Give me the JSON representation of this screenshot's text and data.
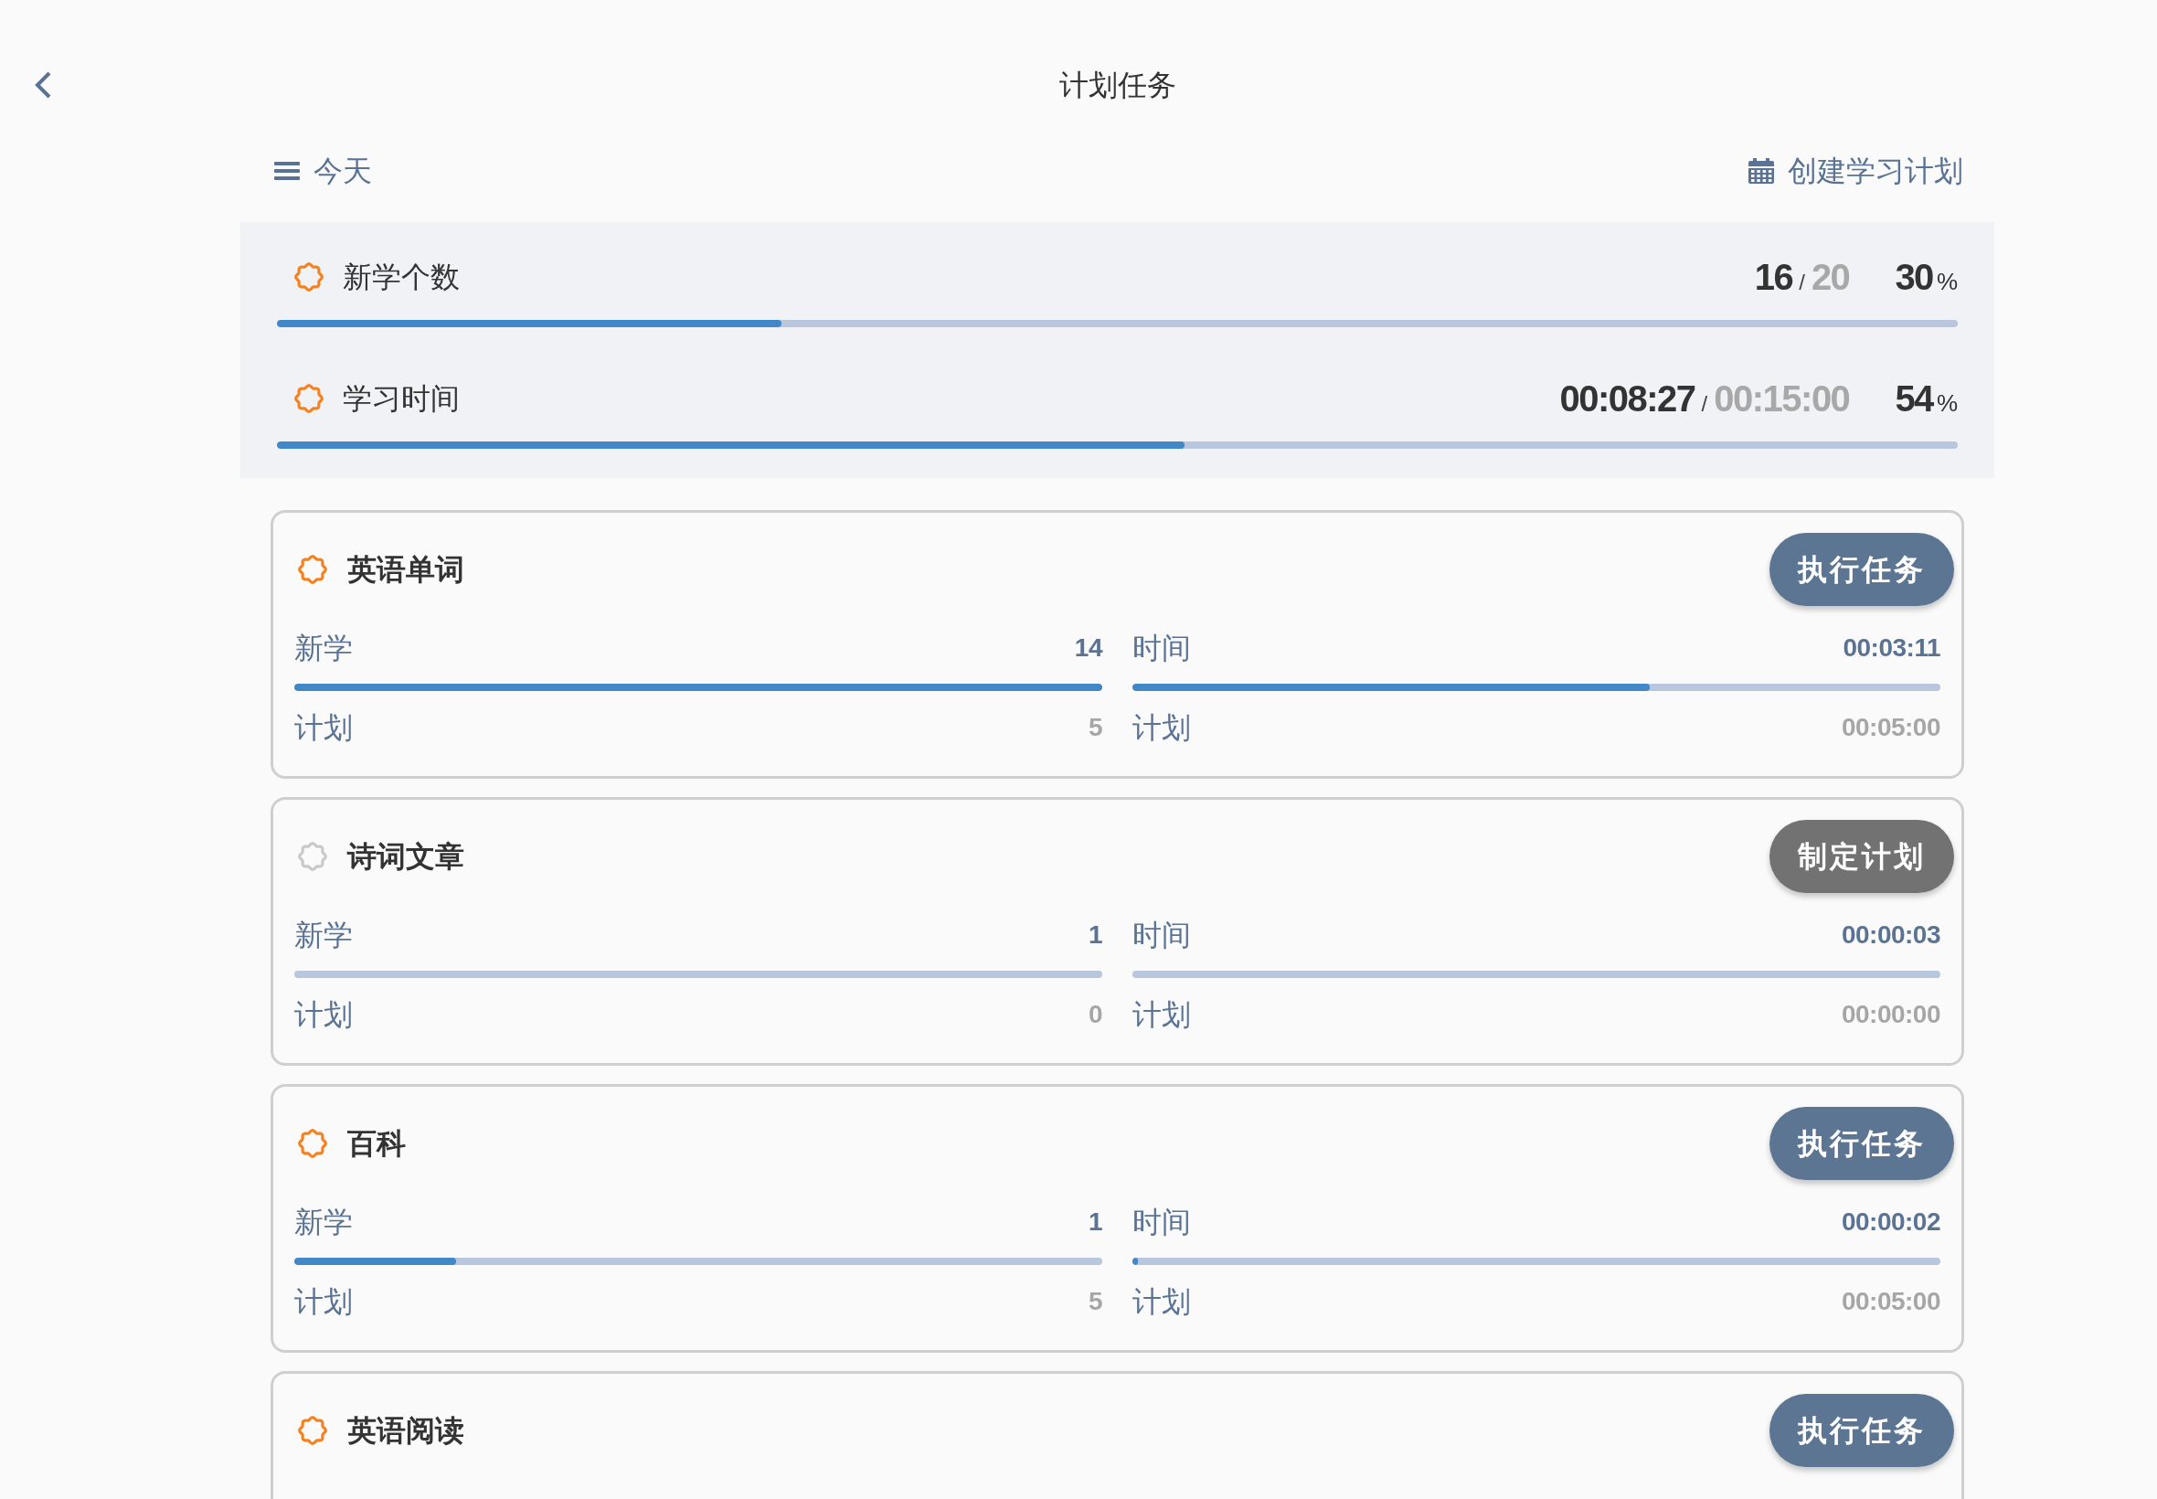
{
  "header": {
    "title": "计划任务"
  },
  "toolbar": {
    "period": "今天",
    "create_plan": "创建学习计划"
  },
  "summary": [
    {
      "label": "新学个数",
      "done": "16",
      "separator": "/",
      "target": "20",
      "percent": "30",
      "unit": "%",
      "level": 0.3
    },
    {
      "label": "学习时间",
      "done": "00:08:27",
      "separator": "/",
      "target": "00:15:00",
      "percent": "54",
      "unit": "%",
      "level": 0.54
    }
  ],
  "tasks": [
    {
      "title": "英语单词",
      "planned": true,
      "button": "执行任务",
      "stats": [
        {
          "label": "新学",
          "value": "14",
          "level": 1,
          "plan_label": "计划",
          "plan_value": "5"
        },
        {
          "label": "时间",
          "value": "00:03:11",
          "level": 0.64,
          "plan_label": "计划",
          "plan_value": "00:05:00"
        }
      ]
    },
    {
      "title": "诗词文章",
      "planned": false,
      "button": "制定计划",
      "stats": [
        {
          "label": "新学",
          "value": "1",
          "level": 0,
          "plan_label": "计划",
          "plan_value": "0"
        },
        {
          "label": "时间",
          "value": "00:00:03",
          "level": 0,
          "plan_label": "计划",
          "plan_value": "00:00:00"
        }
      ]
    },
    {
      "title": "百科",
      "planned": true,
      "button": "执行任务",
      "stats": [
        {
          "label": "新学",
          "value": "1",
          "level": 0.2,
          "plan_label": "计划",
          "plan_value": "5"
        },
        {
          "label": "时间",
          "value": "00:00:02",
          "level": 0.007,
          "plan_label": "计划",
          "plan_value": "00:05:00"
        }
      ]
    },
    {
      "title": "英语阅读",
      "planned": true,
      "button": "执行任务"
    }
  ]
}
